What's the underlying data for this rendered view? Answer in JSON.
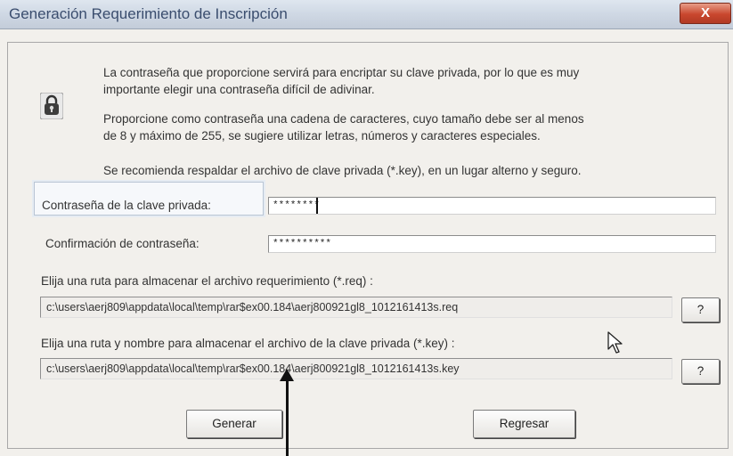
{
  "window": {
    "title": "Generación Requerimiento de Inscripción",
    "close_label": "X"
  },
  "info": {
    "paragraph1_line1": "La contraseña que proporcione servirá para encriptar su clave privada, por lo que es muy",
    "paragraph1_line2": "importante elegir una contraseña difícil de adivinar.",
    "paragraph2_line1": "Proporcione como contraseña una cadena de caracteres, cuyo tamaño debe ser al menos",
    "paragraph2_line2": "de 8 y máximo de 255, se sugiere utilizar letras, números y caracteres especiales.",
    "paragraph3": "Se recomienda respaldar el archivo de clave privada (*.key), en un lugar alterno y seguro."
  },
  "icons": {
    "lock": "lock-icon",
    "cursor": "mouse-pointer-icon"
  },
  "form": {
    "password_label": "Contraseña de la clave privada:",
    "password_value": "********",
    "confirm_label": "Confirmación de contraseña:",
    "confirm_value": "**********"
  },
  "paths": {
    "req_label": "Elija una ruta para almacenar el archivo requerimiento (*.req) :",
    "req_value": "c:\\users\\aerj809\\appdata\\local\\temp\\rar$ex00.184\\aerj800921gl8_1012161413s.req",
    "req_help": "?",
    "key_label": "Elija una ruta y nombre para almacenar el archivo de la clave privada (*.key) :",
    "key_value": "c:\\users\\aerj809\\appdata\\local\\temp\\rar$ex00.184\\aerj800921gl8_1012161413s.key",
    "key_help": "?"
  },
  "buttons": {
    "generate": "Generar",
    "back": "Regresar"
  }
}
